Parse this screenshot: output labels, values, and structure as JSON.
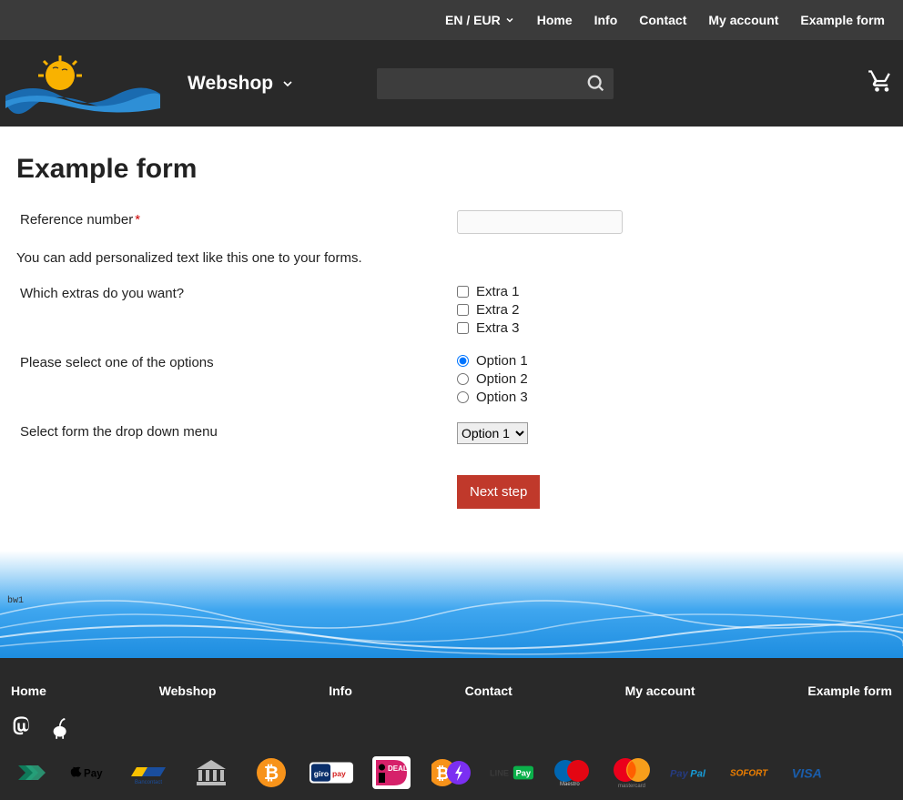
{
  "topbar": {
    "lang_currency": "EN / EUR",
    "links": [
      "Home",
      "Info",
      "Contact",
      "My account",
      "Example form"
    ]
  },
  "header": {
    "webshop_label": "Webshop",
    "search_placeholder": ""
  },
  "page": {
    "title": "Example form",
    "reference_label": "Reference number",
    "info_text": "You can add personalized text like this one to your forms.",
    "extras_label": "Which extras do you want?",
    "extras": [
      "Extra 1",
      "Extra 2",
      "Extra 3"
    ],
    "options_label": "Please select one of the options",
    "options": [
      "Option 1",
      "Option 2",
      "Option 3"
    ],
    "selected_option_index": 0,
    "dropdown_label": "Select form the drop down menu",
    "dropdown_value": "Option 1",
    "next_button": "Next step"
  },
  "banner": {
    "text": "bw1"
  },
  "footer": {
    "links": [
      "Home",
      "Webshop",
      "Info",
      "Contact",
      "My account",
      "Example form"
    ],
    "payments": [
      "afterpay",
      "applepay",
      "bancontact",
      "bank",
      "bitcoin",
      "giropay",
      "ideal",
      "lightning",
      "linepay",
      "maestro",
      "mastercard",
      "paypal",
      "sofort",
      "visa"
    ]
  }
}
